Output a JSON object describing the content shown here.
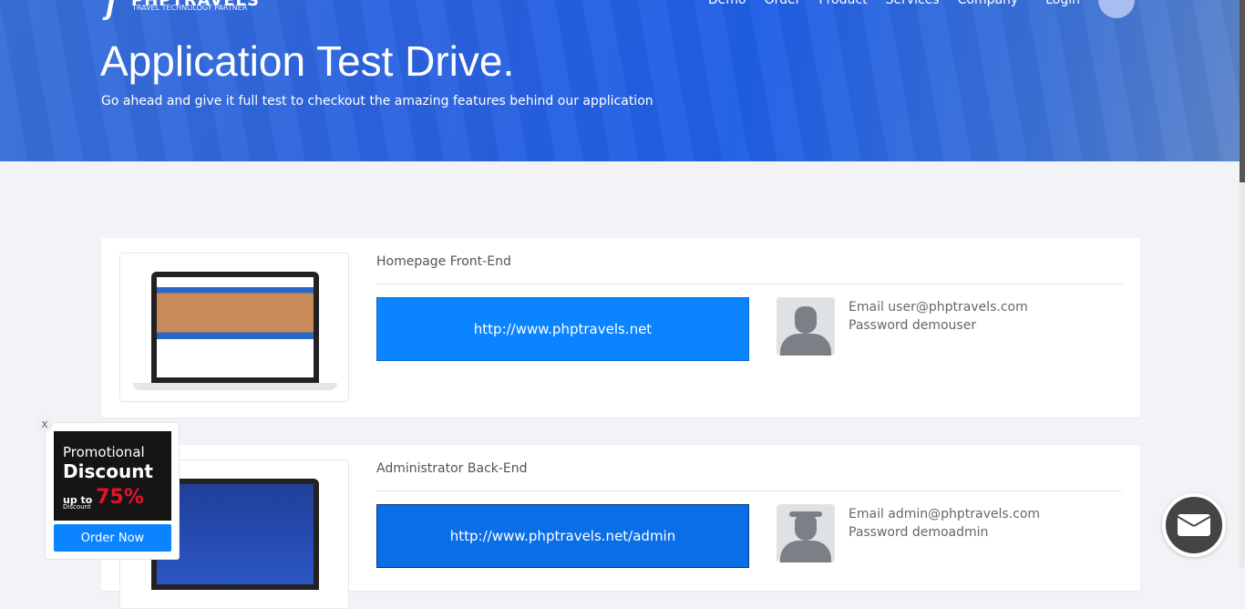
{
  "header": {
    "logo_name": "PHPTRAVELS",
    "logo_tagline": "TRAVEL TECHNOLOGY PARTNER",
    "nav": [
      "Demo",
      "Order",
      "Product",
      "Services",
      "Company",
      "Login"
    ],
    "title": "Application Test Drive.",
    "subtitle": "Go ahead and give it full test to checkout the amazing features behind our application"
  },
  "demos": [
    {
      "title": "Homepage Front-End",
      "url": "http://www.phptravels.net",
      "email": "Email user@phptravels.com",
      "password": "Password demouser"
    },
    {
      "title": "Administrator Back-End",
      "url": "http://www.phptravels.net/admin",
      "email": "Email admin@phptravels.com",
      "password": "Password demoadmin"
    }
  ],
  "promo": {
    "close": "x",
    "line1": "Promotional",
    "line2": "Discount",
    "line3a": "up to",
    "line3b": "75%",
    "line4": "Discount",
    "button": "Order Now"
  },
  "colors": {
    "accent": "#0a84ff",
    "hero": "#2a62e0"
  }
}
